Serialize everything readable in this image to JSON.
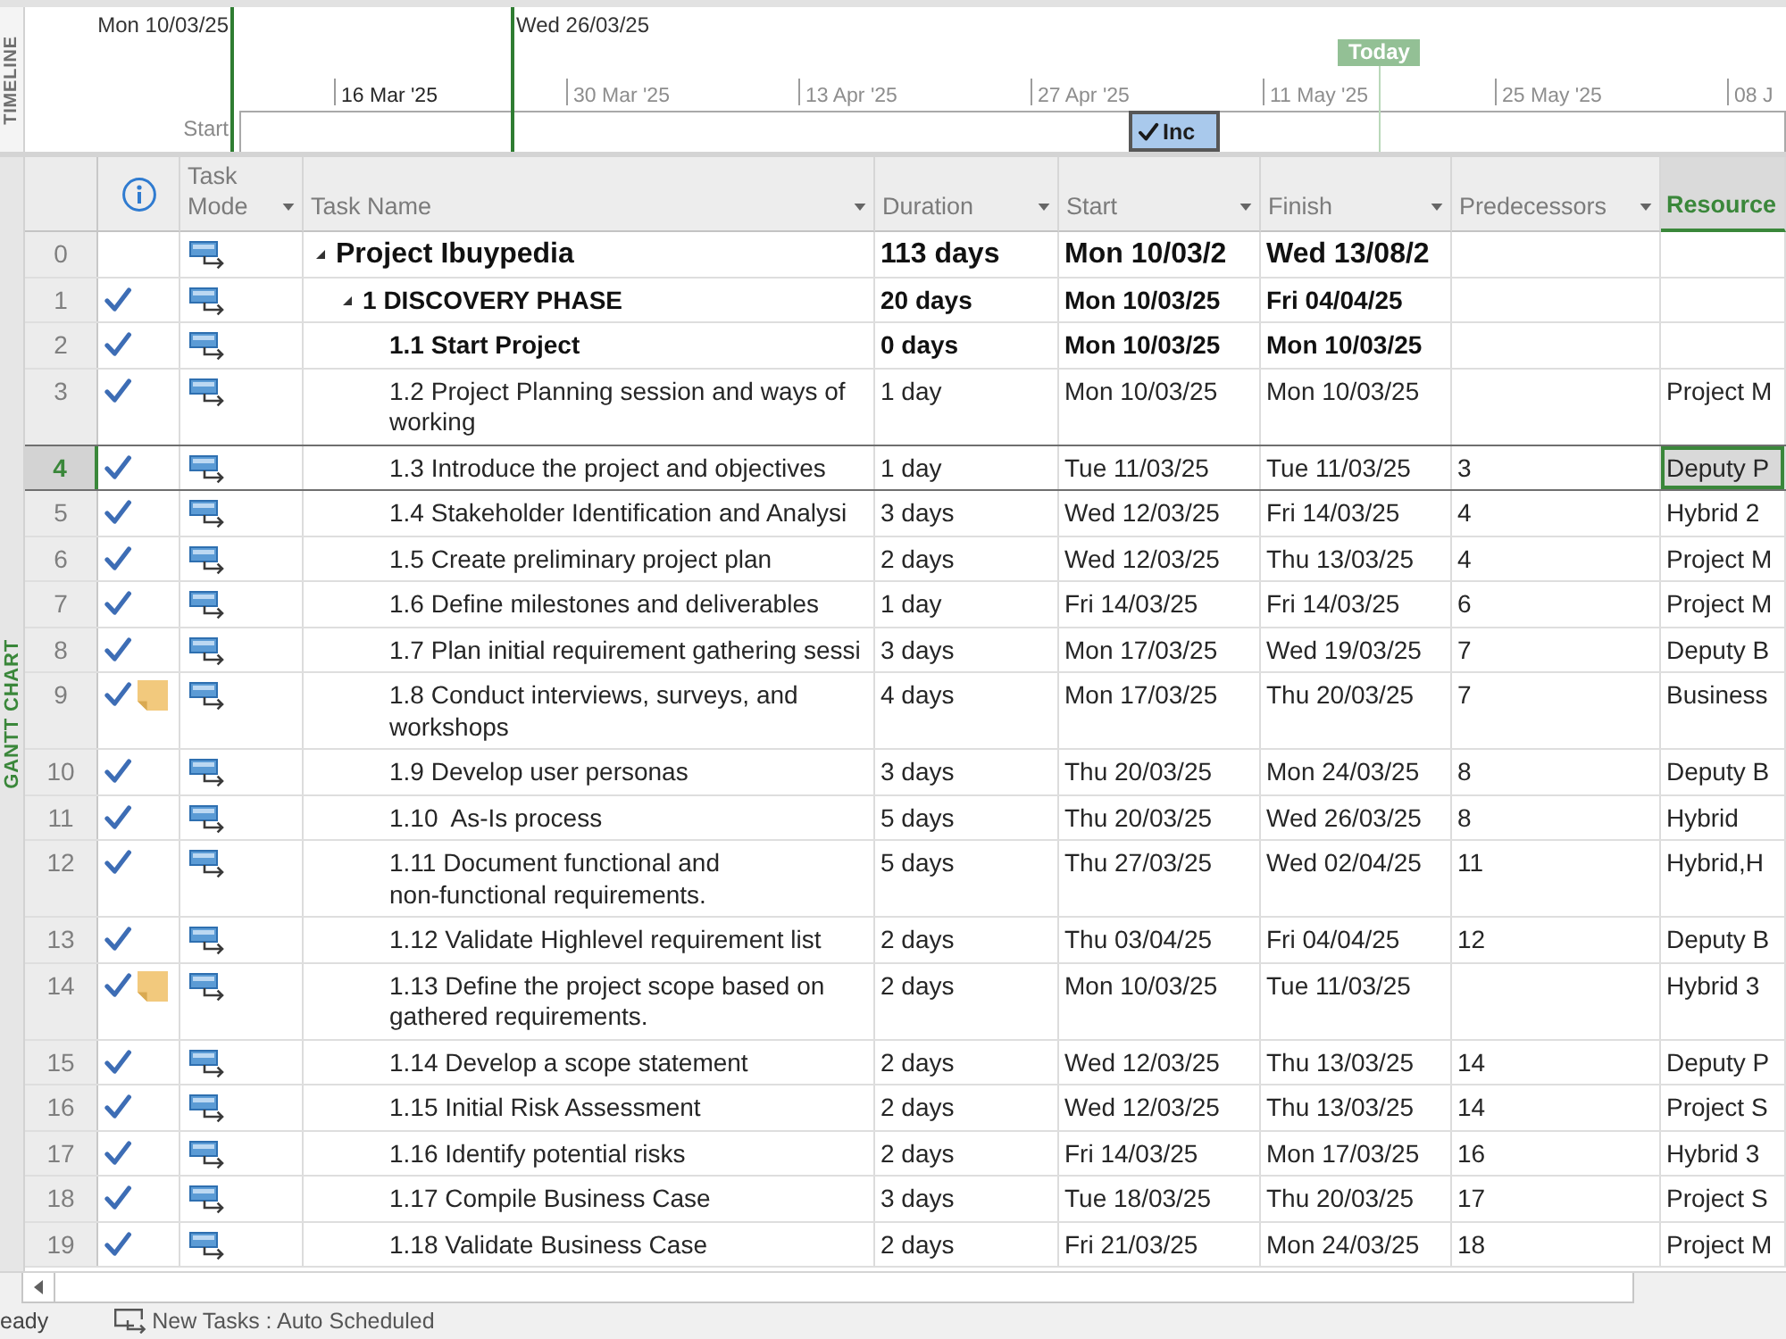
{
  "view_labels": [
    {
      "label": "TIMELINE",
      "selected": false
    },
    {
      "label": "GANTT CHART",
      "selected": true
    }
  ],
  "timeline": {
    "range_start": "Mon 10/03/25",
    "range_finish": "Wed 26/03/25",
    "today": "Today",
    "start_label": "Start",
    "scale": [
      {
        "label": "16 Mar '25",
        "in_range": true
      },
      {
        "label": "30 Mar '25",
        "in_range": false
      },
      {
        "label": "13 Apr '25",
        "in_range": false
      },
      {
        "label": "27 Apr '25",
        "in_range": false
      },
      {
        "label": "11 May '25",
        "in_range": false
      },
      {
        "label": "25 May '25",
        "in_range": false
      },
      {
        "label": "08 J",
        "in_range": false
      }
    ],
    "bars": [
      {
        "label": "Inc",
        "complete": true
      }
    ]
  },
  "table": {
    "columns": [
      {
        "kind": "info",
        "dropdown": false,
        "selected": false
      },
      {
        "kind": "text",
        "label": "Task Mode",
        "dropdown": true,
        "selected": false
      },
      {
        "kind": "text",
        "label": "Task Name",
        "dropdown": true,
        "selected": false
      },
      {
        "kind": "text",
        "label": "Duration",
        "dropdown": true,
        "selected": false
      },
      {
        "kind": "text",
        "label": "Start",
        "dropdown": true,
        "selected": false
      },
      {
        "kind": "text",
        "label": "Finish",
        "dropdown": true,
        "selected": false
      },
      {
        "kind": "text",
        "label": "Predecessors",
        "dropdown": true,
        "selected": false
      },
      {
        "kind": "text",
        "label": "Resource",
        "dropdown": false,
        "selected": true
      }
    ],
    "rows": [
      {
        "id": "0",
        "kind": "project",
        "expanded": true,
        "complete": false,
        "note": false,
        "selected": false,
        "name": "Project Ibuypedia",
        "duration": "113 days",
        "start": "Mon 10/03/2",
        "finish": "Wed 13/08/2",
        "children": [
          {
            "id": "1",
            "kind": "summary",
            "expanded": true,
            "complete": true,
            "note": false,
            "selected": false,
            "name": "1 DISCOVERY PHASE",
            "duration": "20 days",
            "start": "Mon 10/03/25",
            "finish": "Fri 04/04/25",
            "children": [
              {
                "id": "2",
                "kind": "milestone",
                "complete": true,
                "note": false,
                "selected": false,
                "name": "1.1 Start Project",
                "duration": "0 days",
                "start": "Mon 10/03/25",
                "finish": "Mon 10/03/25"
              },
              {
                "id": "3",
                "kind": "task",
                "complete": true,
                "note": false,
                "selected": false,
                "name": "1.2 Project Planning session and ways of working",
                "duration": "1 day",
                "start": "Mon 10/03/25",
                "finish": "Mon 10/03/25",
                "resources": "Project M"
              },
              {
                "id": "4",
                "kind": "task",
                "complete": true,
                "note": false,
                "selected": true,
                "name": "1.3 Introduce the project and objectives",
                "duration": "1 day",
                "start": "Tue 11/03/25",
                "finish": "Tue 11/03/25",
                "predecessors": "3",
                "resources": "Deputy P"
              },
              {
                "id": "5",
                "kind": "task",
                "complete": true,
                "note": false,
                "selected": false,
                "name": "1.4 Stakeholder Identification and Analysi",
                "duration": "3 days",
                "start": "Wed 12/03/25",
                "finish": "Fri 14/03/25",
                "predecessors": "4",
                "resources": "Hybrid 2"
              },
              {
                "id": "6",
                "kind": "task",
                "complete": true,
                "note": false,
                "selected": false,
                "name": "1.5 Create preliminary project plan",
                "duration": "2 days",
                "start": "Wed 12/03/25",
                "finish": "Thu 13/03/25",
                "predecessors": "4",
                "resources": "Project M"
              },
              {
                "id": "7",
                "kind": "task",
                "complete": true,
                "note": false,
                "selected": false,
                "name": "1.6 Define milestones and deliverables",
                "duration": "1 day",
                "start": "Fri 14/03/25",
                "finish": "Fri 14/03/25",
                "predecessors": "6",
                "resources": "Project M"
              },
              {
                "id": "8",
                "kind": "task",
                "complete": true,
                "note": false,
                "selected": false,
                "name": "1.7 Plan initial requirement gathering sessi",
                "duration": "3 days",
                "start": "Mon 17/03/25",
                "finish": "Wed 19/03/25",
                "predecessors": "7",
                "resources": "Deputy B"
              },
              {
                "id": "9",
                "kind": "task",
                "complete": true,
                "note": true,
                "selected": false,
                "name": "1.8 Conduct interviews, surveys, and workshops",
                "duration": "4 days",
                "start": "Mon 17/03/25",
                "finish": "Thu 20/03/25",
                "predecessors": "7",
                "resources": "Business"
              },
              {
                "id": "10",
                "kind": "task",
                "complete": true,
                "note": false,
                "selected": false,
                "name": "1.9 Develop user personas",
                "duration": "3 days",
                "start": "Thu 20/03/25",
                "finish": "Mon 24/03/25",
                "predecessors": "8",
                "resources": "Deputy B"
              },
              {
                "id": "11",
                "kind": "task",
                "complete": true,
                "note": false,
                "selected": false,
                "name": "1.10  As-Is process",
                "duration": "5 days",
                "start": "Thu 20/03/25",
                "finish": "Wed 26/03/25",
                "predecessors": "8",
                "resources": "Hybrid"
              },
              {
                "id": "12",
                "kind": "task",
                "complete": true,
                "note": false,
                "selected": false,
                "name": "1.11 Document functional and non-functional requirements.",
                "duration": "5 days",
                "start": "Thu 27/03/25",
                "finish": "Wed 02/04/25",
                "predecessors": "11",
                "resources": "Hybrid,H"
              },
              {
                "id": "13",
                "kind": "task",
                "complete": true,
                "note": false,
                "selected": false,
                "name": "1.12 Validate Highlevel requirement list",
                "duration": "2 days",
                "start": "Thu 03/04/25",
                "finish": "Fri 04/04/25",
                "predecessors": "12",
                "resources": "Deputy B"
              },
              {
                "id": "14",
                "kind": "task",
                "complete": true,
                "note": true,
                "selected": false,
                "name": "1.13 Define the project scope based on gathered requirements.",
                "duration": "2 days",
                "start": "Mon 10/03/25",
                "finish": "Tue 11/03/25",
                "resources": "Hybrid 3"
              },
              {
                "id": "15",
                "kind": "task",
                "complete": true,
                "note": false,
                "selected": false,
                "name": "1.14 Develop a scope statement",
                "duration": "2 days",
                "start": "Wed 12/03/25",
                "finish": "Thu 13/03/25",
                "predecessors": "14",
                "resources": "Deputy P"
              },
              {
                "id": "16",
                "kind": "task",
                "complete": true,
                "note": false,
                "selected": false,
                "name": "1.15 Initial Risk Assessment",
                "duration": "2 days",
                "start": "Wed 12/03/25",
                "finish": "Thu 13/03/25",
                "predecessors": "14",
                "resources": "Project S"
              },
              {
                "id": "17",
                "kind": "task",
                "complete": true,
                "note": false,
                "selected": false,
                "name": "1.16 Identify potential risks",
                "duration": "2 days",
                "start": "Fri 14/03/25",
                "finish": "Mon 17/03/25",
                "predecessors": "16",
                "resources": "Hybrid 3"
              },
              {
                "id": "18",
                "kind": "task",
                "complete": true,
                "note": false,
                "selected": false,
                "name": "1.17 Compile Business Case",
                "duration": "3 days",
                "start": "Tue 18/03/25",
                "finish": "Thu 20/03/25",
                "predecessors": "17",
                "resources": "Project S"
              },
              {
                "id": "19",
                "kind": "task",
                "complete": true,
                "note": false,
                "selected": false,
                "name": "1.18 Validate Business Case",
                "duration": "2 days",
                "start": "Fri 21/03/25",
                "finish": "Mon 24/03/25",
                "predecessors": "18",
                "resources": "Project M"
              }
            ]
          }
        ]
      }
    ]
  },
  "status_bar": {
    "status": "eady",
    "new_tasks": "New Tasks : Auto Scheduled"
  }
}
